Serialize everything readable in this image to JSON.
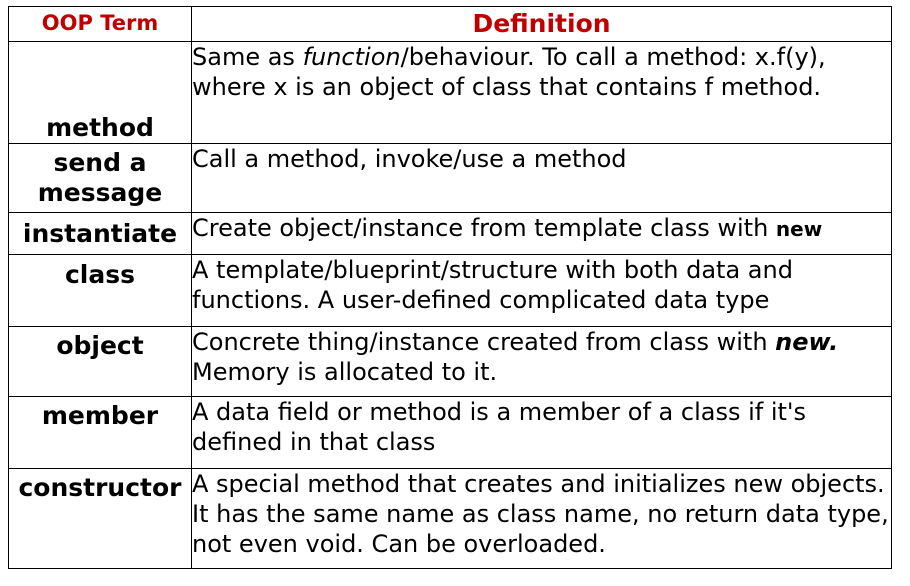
{
  "table": {
    "header": {
      "term": "OOP Term",
      "definition": "Definition"
    },
    "rows": [
      {
        "term": "method",
        "definition": {
          "before": "Same as ",
          "emphasis": "function",
          "after": "/behaviour. To call a method: x.f(y), where x is an object of class that contains f method."
        }
      },
      {
        "term": "send a message",
        "definition": {
          "text": "Call a method, invoke/use a method"
        }
      },
      {
        "term": "instantiate",
        "definition": {
          "before": "Create object/instance from template class with ",
          "keyword": "new"
        }
      },
      {
        "term": "class",
        "definition": {
          "text": "A template/blueprint/structure with both data and functions. A user-defined complicated data type"
        }
      },
      {
        "term": "object",
        "definition": {
          "before": "Concrete thing/instance created from class with ",
          "emphasis": "new.",
          "after": " Memory is allocated to it."
        }
      },
      {
        "term": "member",
        "definition": {
          "text": "A data field or method is a member of a class if it's defined in that class"
        }
      },
      {
        "term": "constructor",
        "definition": {
          "text": "A special method that creates and initializes new objects. It has the same name as class name, no return data type, not even void. Can be overloaded."
        }
      }
    ]
  },
  "colors": {
    "header_text": "#c00000",
    "border": "#000000",
    "text": "#000000",
    "background": "#ffffff"
  }
}
